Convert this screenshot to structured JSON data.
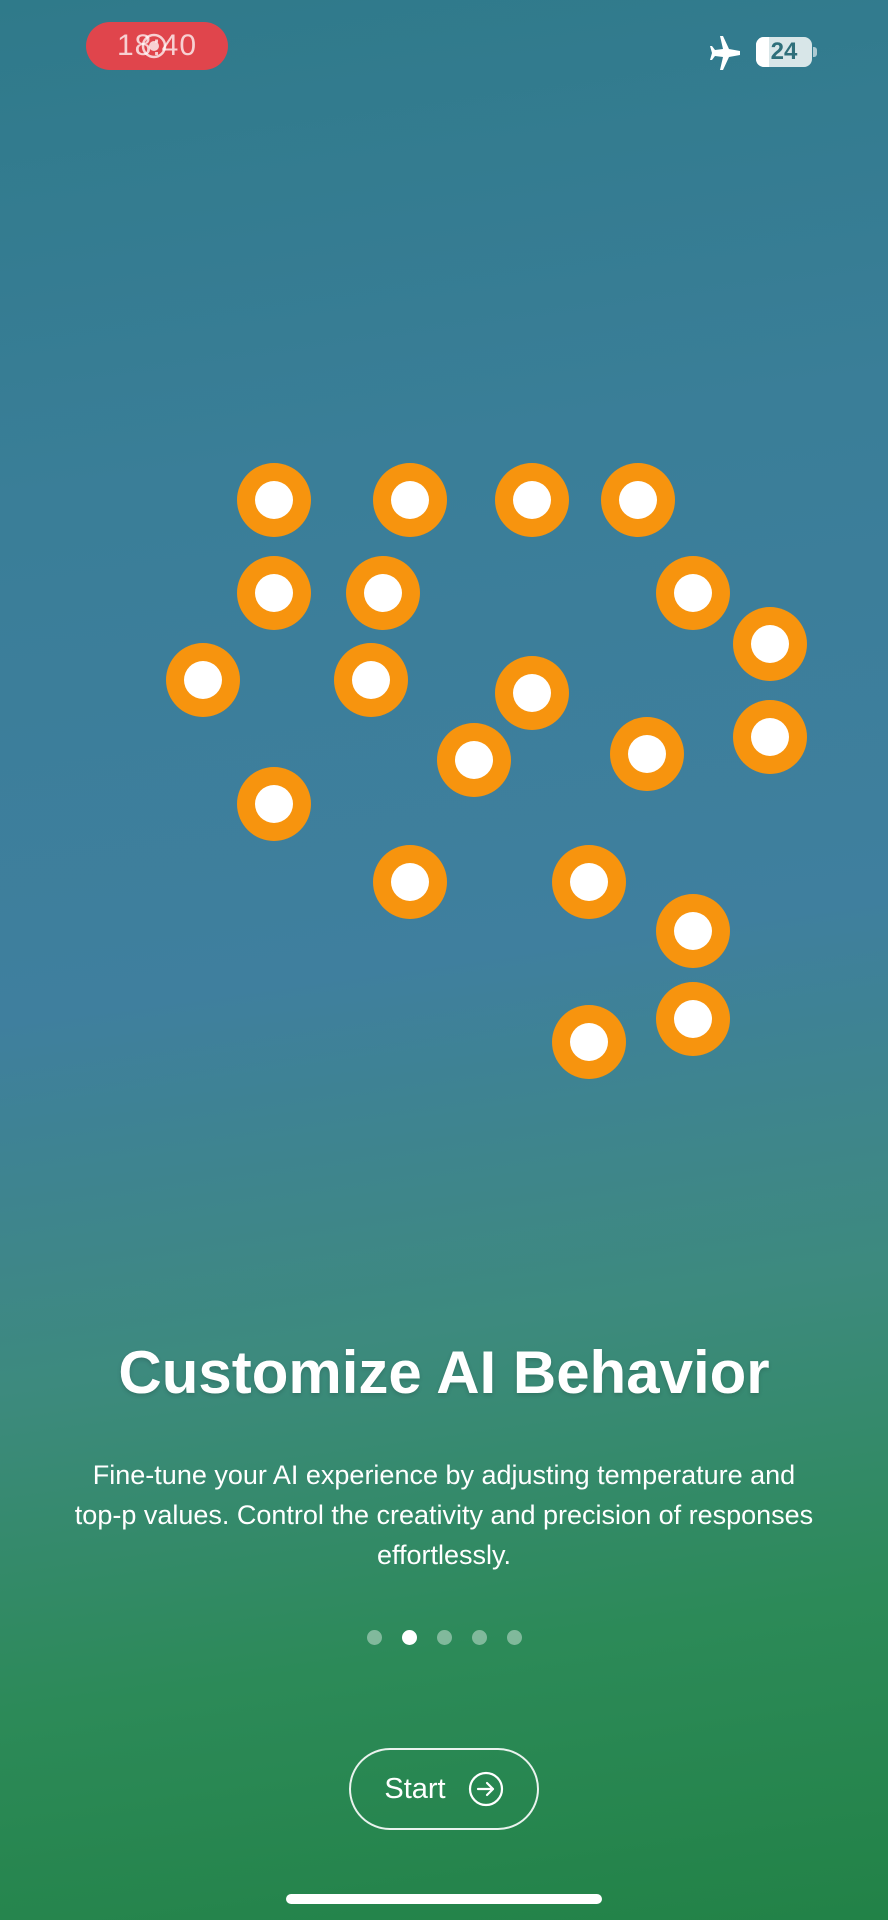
{
  "status_bar": {
    "time": "18:40",
    "battery_level": "24",
    "battery_fraction": 0.24,
    "recording_color": "#e0454c",
    "icons": [
      "screen-recording-icon",
      "airplane-mode-icon",
      "battery-icon"
    ]
  },
  "illustration": {
    "icon": "network-dots-illustration",
    "ring_color": "#f7940e",
    "center_color": "#ffffff"
  },
  "onboarding": {
    "title": "Customize AI Behavior",
    "description": "Fine-tune your AI experience by adjusting temperature and top-p values. Control the creativity and precision of responses effortlessly.",
    "page_count": 5,
    "current_page": 2
  },
  "actions": {
    "start_label": "Start",
    "start_icon": "arrow-right-circle-icon"
  }
}
